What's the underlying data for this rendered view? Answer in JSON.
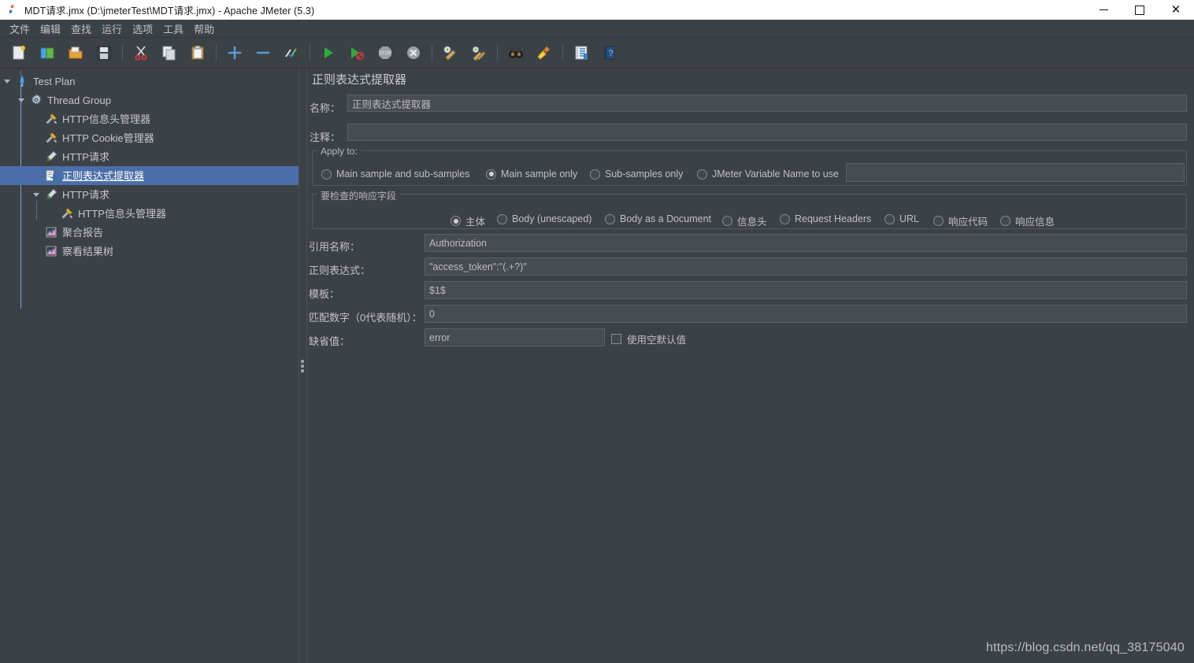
{
  "window": {
    "title": "MDT请求.jmx (D:\\jmeterTest\\MDT请求.jmx) - Apache JMeter (5.3)",
    "app_icon": "jmeter-feather-icon",
    "minimize": "—",
    "maximize": "□",
    "close": "✕"
  },
  "menubar": {
    "items": [
      {
        "label": "文件",
        "name": "menu-file"
      },
      {
        "label": "编辑",
        "name": "menu-edit"
      },
      {
        "label": "查找",
        "name": "menu-search"
      },
      {
        "label": "运行",
        "name": "menu-run"
      },
      {
        "label": "选项",
        "name": "menu-options"
      },
      {
        "label": "工具",
        "name": "menu-tools"
      },
      {
        "label": "帮助",
        "name": "menu-help"
      }
    ]
  },
  "toolbar": {
    "buttons": [
      {
        "icon": "new-document-icon",
        "name": "toolbar-new"
      },
      {
        "icon": "templates-icon",
        "name": "toolbar-templates"
      },
      {
        "icon": "open-folder-icon",
        "name": "toolbar-open"
      },
      {
        "icon": "save-floppy-icon",
        "name": "toolbar-save"
      },
      {
        "icon": "cut-scissors-icon",
        "name": "toolbar-cut"
      },
      {
        "icon": "copy-icon",
        "name": "toolbar-copy"
      },
      {
        "icon": "paste-clipboard-icon",
        "name": "toolbar-paste"
      },
      {
        "icon": "plus-icon",
        "name": "toolbar-expand-all"
      },
      {
        "icon": "minus-icon",
        "name": "toolbar-collapse-all"
      },
      {
        "icon": "toggle-icon",
        "name": "toolbar-toggle"
      },
      {
        "icon": "start-play-icon",
        "name": "toolbar-start"
      },
      {
        "icon": "start-no-pause-icon",
        "name": "toolbar-start-no-timers"
      },
      {
        "icon": "stop-icon",
        "name": "toolbar-stop"
      },
      {
        "icon": "shutdown-icon",
        "name": "toolbar-shutdown"
      },
      {
        "icon": "clear-icon",
        "name": "toolbar-clear"
      },
      {
        "icon": "clear-all-icon",
        "name": "toolbar-clear-all"
      },
      {
        "icon": "search-binoculars-icon",
        "name": "toolbar-search"
      },
      {
        "icon": "reset-search-broom-icon",
        "name": "toolbar-reset-search"
      },
      {
        "icon": "function-helper-icon",
        "name": "toolbar-function-helper"
      },
      {
        "icon": "help-book-icon",
        "name": "toolbar-help"
      }
    ]
  },
  "tree": {
    "nodes": [
      {
        "label": "Test Plan",
        "icon": "test-plan-icon",
        "depth": 0,
        "expanded": true,
        "selected": false
      },
      {
        "label": "Thread Group",
        "icon": "thread-group-gear-icon",
        "depth": 1,
        "expanded": true,
        "selected": false
      },
      {
        "label": "HTTP信息头管理器",
        "icon": "header-manager-icon",
        "depth": 2,
        "expanded": null,
        "selected": false
      },
      {
        "label": "HTTP Cookie管理器",
        "icon": "cookie-manager-icon",
        "depth": 2,
        "expanded": null,
        "selected": false
      },
      {
        "label": "HTTP请求",
        "icon": "http-request-icon",
        "depth": 2,
        "expanded": null,
        "selected": false
      },
      {
        "label": "正则表达式提取器",
        "icon": "regex-extractor-icon",
        "depth": 2,
        "expanded": null,
        "selected": true
      },
      {
        "label": "HTTP请求",
        "icon": "http-request-icon",
        "depth": 2,
        "expanded": true,
        "selected": false
      },
      {
        "label": "HTTP信息头管理器",
        "icon": "header-manager-icon",
        "depth": 3,
        "expanded": null,
        "selected": false
      },
      {
        "label": "聚合报告",
        "icon": "aggregate-report-icon",
        "depth": 2,
        "expanded": null,
        "selected": false
      },
      {
        "label": "察看结果树",
        "icon": "view-results-tree-icon",
        "depth": 2,
        "expanded": null,
        "selected": false
      }
    ]
  },
  "main": {
    "panel_title": "正则表达式提取器",
    "name_label": "名称：",
    "name_value": "正则表达式提取器",
    "comment_label": "注释：",
    "comment_value": "",
    "apply_to": {
      "group_title": "Apply to:",
      "options": [
        {
          "label": "Main sample and sub-samples",
          "checked": false,
          "name": "radio-main-and-sub"
        },
        {
          "label": "Main sample only",
          "checked": true,
          "name": "radio-main-only"
        },
        {
          "label": "Sub-samples only",
          "checked": false,
          "name": "radio-sub-only"
        },
        {
          "label": "JMeter Variable Name to use",
          "checked": false,
          "name": "radio-jmeter-variable"
        }
      ],
      "variable_value": ""
    },
    "response_field": {
      "group_title": "要检查的响应字段",
      "options": [
        {
          "label": "主体",
          "checked": true,
          "name": "radio-body"
        },
        {
          "label": "Body (unescaped)",
          "checked": false,
          "name": "radio-body-unescaped"
        },
        {
          "label": "Body as a Document",
          "checked": false,
          "name": "radio-body-as-document"
        },
        {
          "label": "信息头",
          "checked": false,
          "name": "radio-response-headers"
        },
        {
          "label": "Request Headers",
          "checked": false,
          "name": "radio-request-headers"
        },
        {
          "label": "URL",
          "checked": false,
          "name": "radio-url"
        },
        {
          "label": "响应代码",
          "checked": false,
          "name": "radio-response-code"
        },
        {
          "label": "响应信息",
          "checked": false,
          "name": "radio-response-message"
        }
      ]
    },
    "fields": {
      "refname_label": "引用名称：",
      "refname_value": "Authorization",
      "regex_label": "正则表达式：",
      "regex_value": "\"access_token\":\"(.+?)\"",
      "template_label": "模板：",
      "template_value": "$1$",
      "matchno_label": "匹配数字（0代表随机）：",
      "matchno_value": "0",
      "default_label": "缺省值：",
      "default_value": "error",
      "use_empty_default_label": "使用空默认值",
      "use_empty_default_checked": false
    }
  },
  "watermark": "https://blog.csdn.net/qq_38175040",
  "colors": {
    "background": "#3c4146",
    "selection": "#4a6ea8",
    "field_bg": "#474c51",
    "text": "#c0c4c7",
    "titlebar_bg": "#ffffff"
  }
}
